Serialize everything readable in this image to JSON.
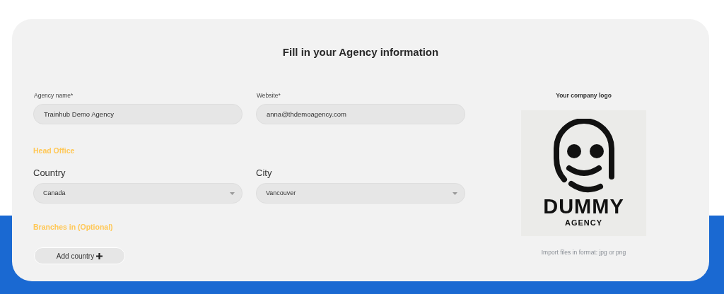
{
  "title": "Fill in your Agency information",
  "agency_name": {
    "label": "Agency name*",
    "value": "Trainhub Demo Agency"
  },
  "website": {
    "label": "Website*",
    "value": "anna@thdemoagency.com"
  },
  "head_office": {
    "heading": "Head Office",
    "country": {
      "label": "Country",
      "value": "Canada"
    },
    "city": {
      "label": "City",
      "value": "Vancouver"
    }
  },
  "branches": {
    "heading": "Branches in (Optional)",
    "add_button": "Add country"
  },
  "logo": {
    "label": "Your company logo",
    "wordmark": "DUMMY",
    "subtitle": "AGENCY",
    "hint": "Import files in format: jpg or png"
  }
}
